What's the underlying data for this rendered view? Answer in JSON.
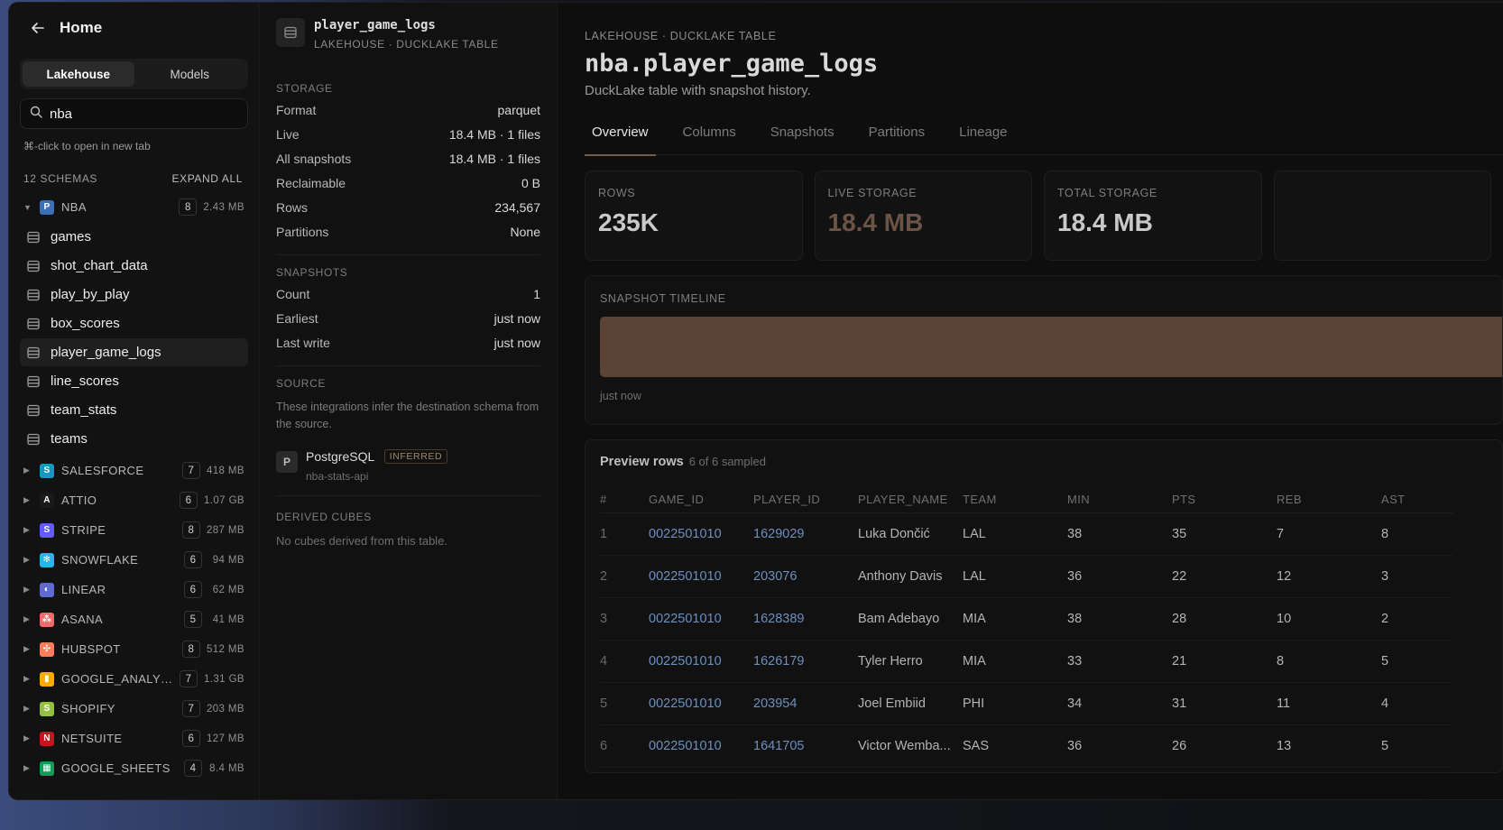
{
  "sidebar": {
    "home_label": "Home",
    "segments": [
      "Lakehouse",
      "Models"
    ],
    "search_value": "nba",
    "hint": "⌘-click to open in new tab",
    "schemas_count_label": "12 SCHEMAS",
    "expand_all": "EXPAND ALL",
    "nba": {
      "name": "NBA",
      "logo_letter": "P",
      "count": "8",
      "size": "2.43 MB"
    },
    "tables": [
      "games",
      "shot_chart_data",
      "play_by_play",
      "box_scores",
      "player_game_logs",
      "line_scores",
      "team_stats",
      "teams"
    ],
    "schemas": [
      {
        "name": "SALESFORCE",
        "logo": "S",
        "color": "#1798c1",
        "count": "7",
        "size": "418 MB"
      },
      {
        "name": "ATTIO",
        "logo": "A",
        "color": "#1a1a1a",
        "count": "6",
        "size": "1.07 GB"
      },
      {
        "name": "STRIPE",
        "logo": "S",
        "color": "#635bff",
        "count": "8",
        "size": "287 MB"
      },
      {
        "name": "SNOWFLAKE",
        "logo": "✻",
        "color": "#29b5e8",
        "count": "6",
        "size": "94 MB"
      },
      {
        "name": "LINEAR",
        "logo": "◐",
        "color": "#5e6ad2",
        "count": "6",
        "size": "62 MB"
      },
      {
        "name": "ASANA",
        "logo": "⁂",
        "color": "#f06a6a",
        "count": "5",
        "size": "41 MB"
      },
      {
        "name": "HUBSPOT",
        "logo": "✣",
        "color": "#ff7a59",
        "count": "8",
        "size": "512 MB"
      },
      {
        "name": "GOOGLE_ANALYTICS",
        "logo": "▮",
        "color": "#f9ab00",
        "count": "7",
        "size": "1.31 GB"
      },
      {
        "name": "SHOPIFY",
        "logo": "S",
        "color": "#95bf47",
        "count": "7",
        "size": "203 MB"
      },
      {
        "name": "NETSUITE",
        "logo": "N",
        "color": "#c4161c",
        "count": "6",
        "size": "127 MB"
      },
      {
        "name": "GOOGLE_SHEETS",
        "logo": "▦",
        "color": "#0f9d58",
        "count": "4",
        "size": "8.4 MB"
      }
    ]
  },
  "detail": {
    "name": "player_game_logs",
    "subtitle": "LAKEHOUSE · DUCKLAKE TABLE",
    "storage_title": "STORAGE",
    "storage": [
      {
        "k": "Format",
        "v": "parquet"
      },
      {
        "k": "Live",
        "v": "18.4 MB · 1 files"
      },
      {
        "k": "All snapshots",
        "v": "18.4 MB · 1 files"
      },
      {
        "k": "Reclaimable",
        "v": "0 B"
      },
      {
        "k": "Rows",
        "v": "234,567"
      },
      {
        "k": "Partitions",
        "v": "None"
      }
    ],
    "snapshots_title": "SNAPSHOTS",
    "snapshots": [
      {
        "k": "Count",
        "v": "1"
      },
      {
        "k": "Earliest",
        "v": "just now"
      },
      {
        "k": "Last write",
        "v": "just now"
      }
    ],
    "source_title": "SOURCE",
    "source_note": "These integrations infer the destination schema from the source.",
    "source_name": "PostgreSQL",
    "source_badge": "INFERRED",
    "source_sub": "nba-stats-api",
    "derived_title": "DERIVED CUBES",
    "derived_note": "No cubes derived from this table."
  },
  "main": {
    "crumb": "LAKEHOUSE · DUCKLAKE TABLE",
    "title": "nba.player_game_logs",
    "subtitle": "DuckLake table with snapshot history.",
    "tabs": [
      "Overview",
      "Columns",
      "Snapshots",
      "Partitions",
      "Lineage"
    ],
    "stats": [
      {
        "label": "ROWS",
        "value": "235K"
      },
      {
        "label": "LIVE STORAGE",
        "value": "18.4 MB"
      },
      {
        "label": "TOTAL STORAGE",
        "value": "18.4 MB"
      }
    ],
    "timeline_label": "SNAPSHOT TIMELINE",
    "timeline_when": "just now",
    "preview_title": "Preview rows",
    "preview_sampled": "6 of 6 sampled",
    "columns": [
      "#",
      "GAME_ID",
      "PLAYER_ID",
      "PLAYER_NAME",
      "TEAM",
      "MIN",
      "PTS",
      "REB",
      "AST"
    ],
    "rows": [
      [
        "1",
        "0022501010",
        "1629029",
        "Luka Dončić",
        "LAL",
        "38",
        "35",
        "7",
        "8"
      ],
      [
        "2",
        "0022501010",
        "203076",
        "Anthony Davis",
        "LAL",
        "36",
        "22",
        "12",
        "3"
      ],
      [
        "3",
        "0022501010",
        "1628389",
        "Bam Adebayo",
        "MIA",
        "38",
        "28",
        "10",
        "2"
      ],
      [
        "4",
        "0022501010",
        "1626179",
        "Tyler Herro",
        "MIA",
        "33",
        "21",
        "8",
        "5"
      ],
      [
        "5",
        "0022501010",
        "203954",
        "Joel Embiid",
        "PHI",
        "34",
        "31",
        "11",
        "4"
      ],
      [
        "6",
        "0022501010",
        "1641705",
        "Victor Wemba...",
        "SAS",
        "36",
        "26",
        "13",
        "5"
      ]
    ]
  }
}
